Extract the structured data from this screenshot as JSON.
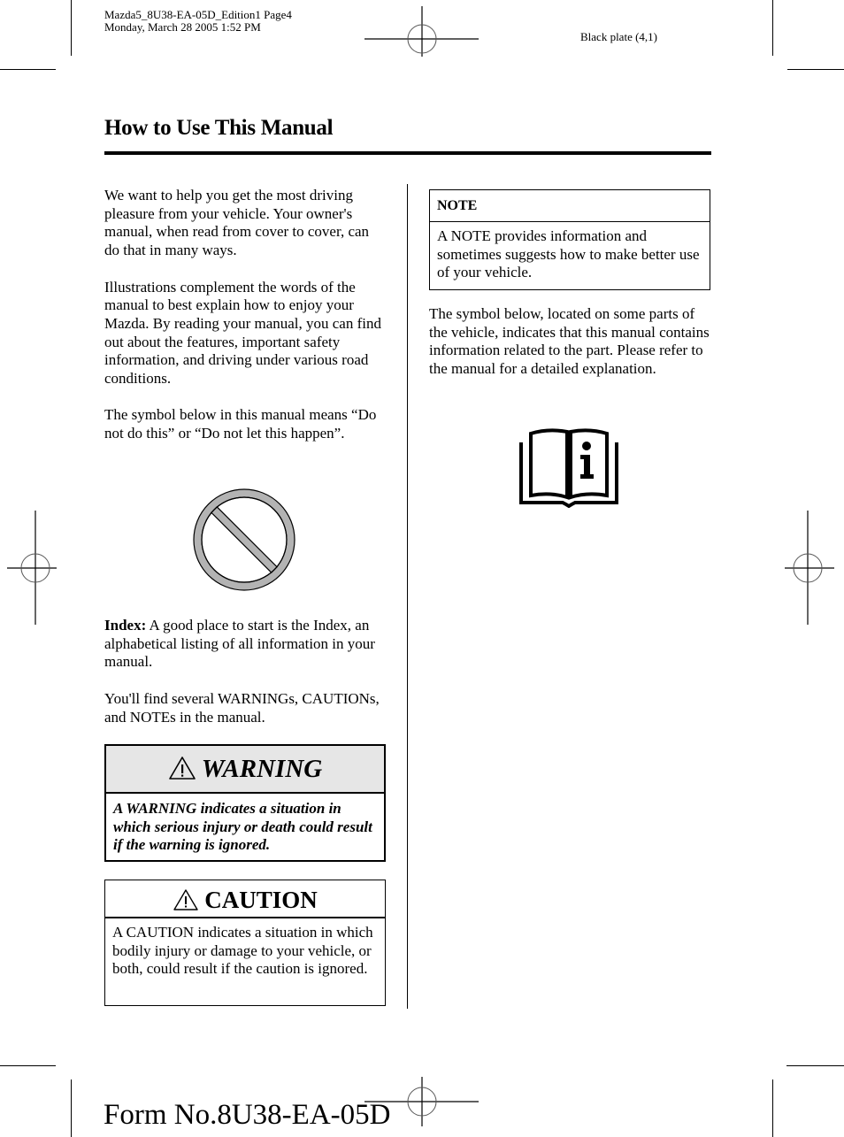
{
  "slug": {
    "line1": "Mazda5_8U38-EA-05D_Edition1 Page4",
    "line2": "Monday, March 28 2005 1:52 PM"
  },
  "plate": "Black plate (4,1)",
  "page_title": "How to Use This Manual",
  "left_column": {
    "paragraphs": [
      "We want to help you get the most driving pleasure from your vehicle. Your owner's manual, when read from cover to cover, can do that in many ways.",
      "Illustrations complement the words of the manual to best explain how to enjoy your Mazda. By reading your manual, you can find out about the features, important safety information, and driving under various road conditions.",
      "The symbol below in this manual means “Do not do this” or “Do not let this happen”."
    ],
    "prohibition_symbol": "prohibition-icon",
    "index_label": "Index:",
    "index_text": " A good place to start is the Index, an alphabetical listing of all information in your manual.",
    "several_text": "You'll find several WARNINGs, CAUTIONs, and NOTEs in the manual."
  },
  "warning_box": {
    "title": "WARNING",
    "icon": "warning-triangle-icon",
    "text": "A WARNING indicates a situation in which serious injury or death could result if the warning is ignored."
  },
  "caution_box": {
    "title": "CAUTION",
    "icon": "warning-triangle-icon",
    "text": "A CAUTION indicates a situation in which bodily injury or damage to your vehicle, or both, could result if the caution is ignored."
  },
  "note_box": {
    "title": "NOTE",
    "text": "A NOTE provides information and sometimes suggests how to make better use of your vehicle."
  },
  "right_column": {
    "symbol_text": "The symbol below, located on some parts of the vehicle, indicates that this manual contains information related to the part. Please refer to the manual for a detailed explanation.",
    "manual_symbol": "manual-info-book-icon"
  },
  "footer": "Form No.8U38-EA-05D",
  "colors": {
    "warning_header_bg": "#e6e6e6",
    "prohibition_fill": "#b3b3b3"
  }
}
